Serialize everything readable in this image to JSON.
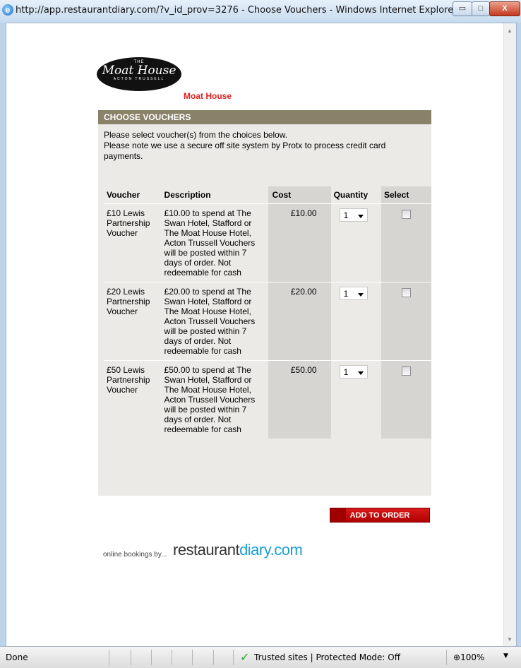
{
  "window": {
    "title": "http://app.restaurantdiary.com/?v_id_prov=3276 - Choose Vouchers - Windows Internet Explorer",
    "minimize_glyph": "▭",
    "maximize_glyph": "□",
    "close_glyph": "X"
  },
  "venue": {
    "logo_the": "THE",
    "logo_name": "Moat House",
    "logo_sub": "ACTON TRUSSELL",
    "name": "Moat House"
  },
  "panel": {
    "header": "CHOOSE VOUCHERS",
    "intro_line1": "Please select voucher(s) from the choices below.",
    "intro_line2": "Please note we use a secure off site system by Protx to process credit card payments."
  },
  "table": {
    "headers": [
      "Voucher",
      "Description",
      "Cost",
      "Quantity",
      "Select"
    ],
    "rows": [
      {
        "voucher": "£10 Lewis Partnership Voucher",
        "description": "£10.00 to spend at The Swan Hotel, Stafford or The Moat House Hotel, Acton Trussell Vouchers will be posted within 7 days of order. Not redeemable for cash",
        "cost": "£10.00",
        "quantity": "1"
      },
      {
        "voucher": "£20 Lewis Partnership Voucher",
        "description": "£20.00 to spend at The Swan Hotel, Stafford or The Moat House Hotel, Acton Trussell Vouchers will be posted within 7 days of order. Not redeemable for cash",
        "cost": "£20.00",
        "quantity": "1"
      },
      {
        "voucher": "£50 Lewis Partnership Voucher",
        "description": "£50.00 to spend at The Swan Hotel, Stafford or The Moat House Hotel, Acton Trussell Vouchers will be posted within 7 days of order. Not redeemable for cash",
        "cost": "£50.00",
        "quantity": "1"
      }
    ]
  },
  "add_button_label": "ADD TO ORDER",
  "powered_by": {
    "prefix": "online bookings by...",
    "brand_main": "restaurant",
    "brand_accent": "diary.com"
  },
  "statusbar": {
    "status": "Done",
    "zone": "Trusted sites | Protected Mode: Off",
    "zoom": "100%"
  },
  "colors": {
    "header_bg": "#8a8169",
    "panel_bg": "#ebeae6",
    "venue_red": "#e02020",
    "button_red": "#cc0000",
    "brand_blue": "#1a9ed8"
  }
}
